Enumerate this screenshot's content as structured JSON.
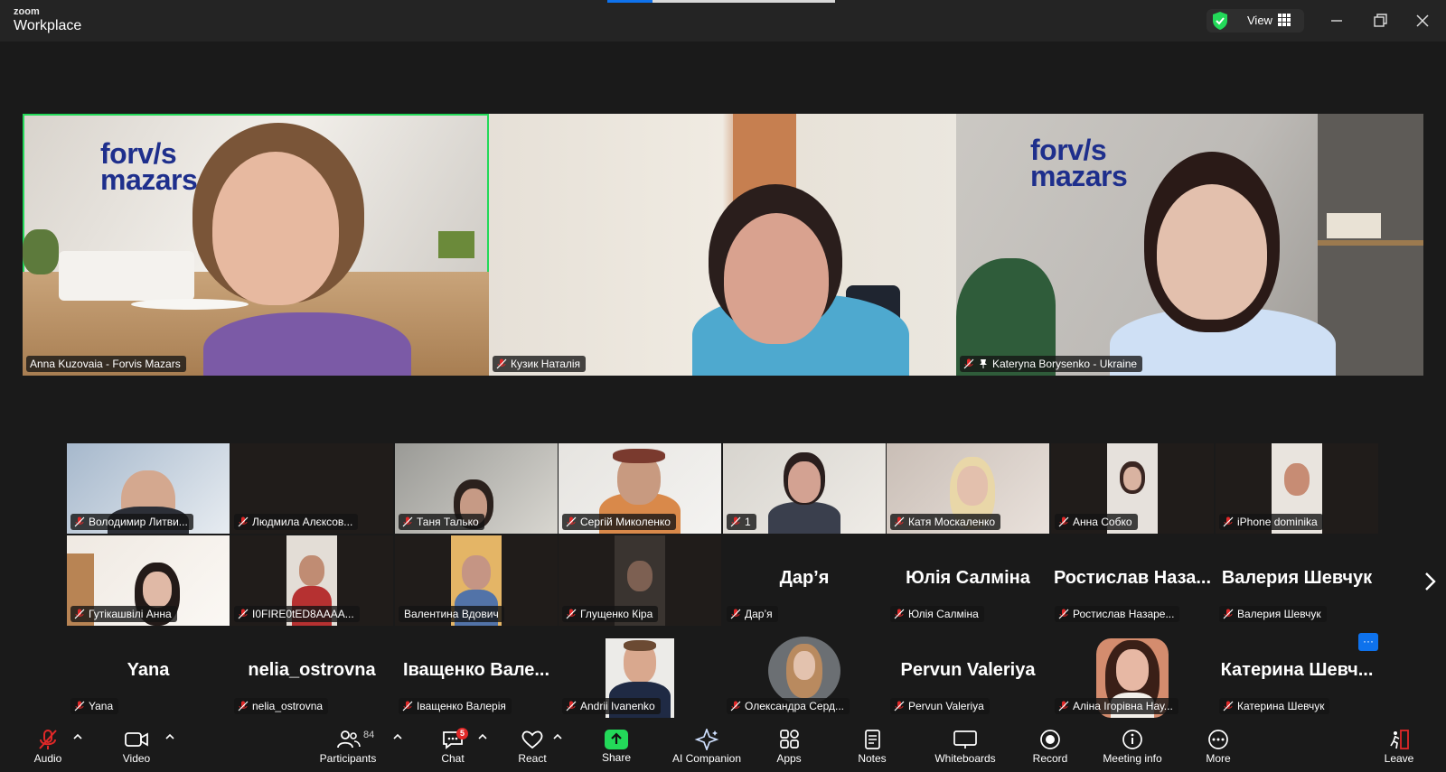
{
  "app": {
    "logo_top": "zoom",
    "logo_bottom": "Workplace"
  },
  "titlebar": {
    "view_label": "View"
  },
  "main_speakers": [
    {
      "name": "Anna Kuzovaia - Forvis Mazars",
      "brand_line1": "forv/s",
      "brand_line2": "mazars",
      "muted": false,
      "pinned": false,
      "active": true
    },
    {
      "name": "Кузик Наталія",
      "muted": true,
      "pinned": false
    },
    {
      "name": "Kateryna Borysenko - Ukraine",
      "brand_line1": "forv/s",
      "brand_line2": "mazars",
      "muted": true,
      "pinned": true
    }
  ],
  "gallery": {
    "row1": [
      {
        "label": "Володимир Литви...",
        "video": true
      },
      {
        "label": "Людмила Алєксов...",
        "video": false
      },
      {
        "label": "Таня Талько",
        "video": true
      },
      {
        "label": "Сергій Миколенко",
        "video": true
      },
      {
        "label": "1",
        "video": true
      },
      {
        "label": "Катя Москаленко",
        "video": true
      },
      {
        "label": "Анна Собко",
        "video": true
      },
      {
        "label": "iPhone dominika",
        "video": true
      }
    ],
    "row2": [
      {
        "label": "Гутікашвілі Анна",
        "video": true
      },
      {
        "label": "I0FIRE0tED8AAAA...",
        "video": true
      },
      {
        "label": "Валентина Вдович",
        "video": true,
        "muted": false
      },
      {
        "label": "Глущенко Кіра",
        "video": true
      },
      {
        "label": "Дар’я",
        "big": "Дар’я"
      },
      {
        "label": "Юлія Салміна",
        "big": "Юлія Салміна"
      },
      {
        "label": "Ростислав Назаре...",
        "big": "Ростислав Наза..."
      },
      {
        "label": "Валерия Шевчук",
        "big": "Валерия Шевчук"
      }
    ],
    "row3": [
      {
        "label": "Yana",
        "big": "Yana"
      },
      {
        "label": "nelia_ostrovna",
        "big": "nelia_ostrovna"
      },
      {
        "label": "Іващенко Валерія",
        "big": "Іващенко Вале..."
      },
      {
        "label": "Andrii Ivanenko",
        "video": true
      },
      {
        "label": "Олександра Серд...",
        "video": true
      },
      {
        "label": "Pervun Valeriya",
        "big": "Pervun Valeriya"
      },
      {
        "label": "Аліна Ігорівна Нау...",
        "video": true
      },
      {
        "label": "Катерина Шевчук",
        "big": "Катерина Шевч..."
      }
    ],
    "more_badge": "···"
  },
  "toolbar": {
    "audio": "Audio",
    "video": "Video",
    "participants": "Participants",
    "participants_count": "84",
    "chat": "Chat",
    "chat_badge": "5",
    "react": "React",
    "share": "Share",
    "ai_companion": "AI Companion",
    "apps": "Apps",
    "notes": "Notes",
    "whiteboards": "Whiteboards",
    "record": "Record",
    "meeting_info": "Meeting info",
    "more": "More",
    "leave": "Leave"
  },
  "colors": {
    "active_speaker": "#23d959",
    "accent": "#0e72ed",
    "mute_red": "#e02828",
    "brand_blue": "#1e2f8c"
  }
}
